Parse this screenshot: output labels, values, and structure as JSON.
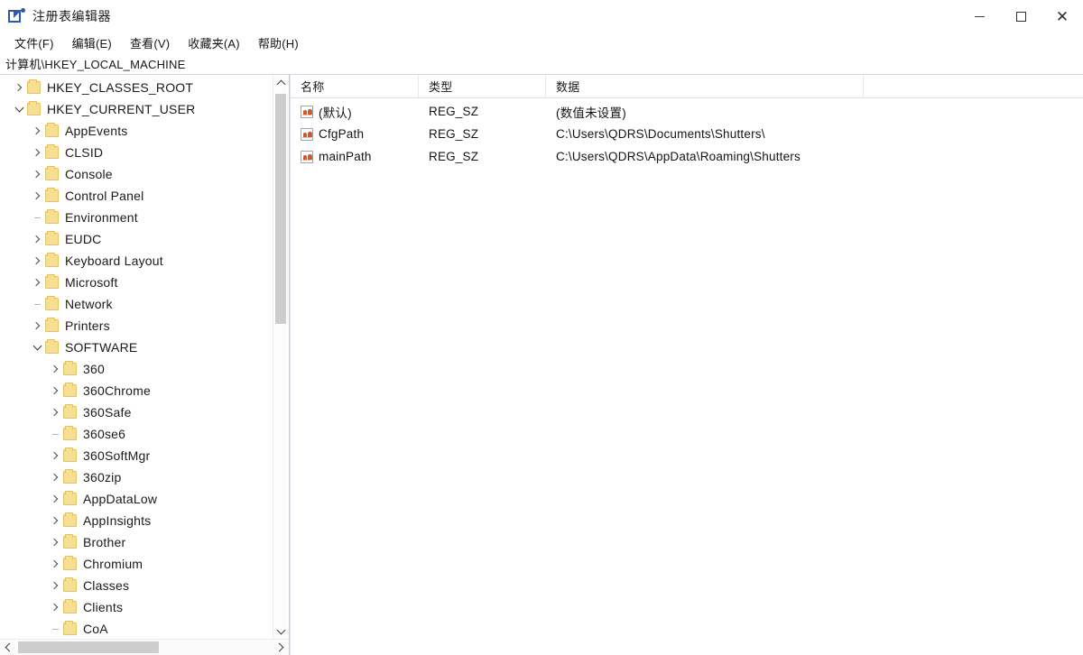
{
  "window": {
    "title": "注册表编辑器",
    "icon": "registry-editor-icon",
    "minimize_label": "最小化",
    "maximize_label": "最大化",
    "close_label": "关闭"
  },
  "menubar": {
    "items": [
      {
        "label": "文件(F)",
        "name": "menu-file"
      },
      {
        "label": "编辑(E)",
        "name": "menu-edit"
      },
      {
        "label": "查看(V)",
        "name": "menu-view"
      },
      {
        "label": "收藏夹(A)",
        "name": "menu-favorites"
      },
      {
        "label": "帮助(H)",
        "name": "menu-help"
      }
    ]
  },
  "address": {
    "path": "计算机\\HKEY_LOCAL_MACHINE"
  },
  "tree": {
    "items": [
      {
        "label": "HKEY_CLASSES_ROOT",
        "level": 0,
        "state": "collapsed"
      },
      {
        "label": "HKEY_CURRENT_USER",
        "level": 0,
        "state": "expanded"
      },
      {
        "label": "AppEvents",
        "level": 1,
        "state": "collapsed"
      },
      {
        "label": "CLSID",
        "level": 1,
        "state": "collapsed"
      },
      {
        "label": "Console",
        "level": 1,
        "state": "collapsed"
      },
      {
        "label": "Control Panel",
        "level": 1,
        "state": "collapsed"
      },
      {
        "label": "Environment",
        "level": 1,
        "state": "leaf"
      },
      {
        "label": "EUDC",
        "level": 1,
        "state": "collapsed"
      },
      {
        "label": "Keyboard Layout",
        "level": 1,
        "state": "collapsed"
      },
      {
        "label": "Microsoft",
        "level": 1,
        "state": "collapsed"
      },
      {
        "label": "Network",
        "level": 1,
        "state": "leaf"
      },
      {
        "label": "Printers",
        "level": 1,
        "state": "collapsed"
      },
      {
        "label": "SOFTWARE",
        "level": 1,
        "state": "expanded"
      },
      {
        "label": "360",
        "level": 2,
        "state": "collapsed"
      },
      {
        "label": "360Chrome",
        "level": 2,
        "state": "collapsed"
      },
      {
        "label": "360Safe",
        "level": 2,
        "state": "collapsed"
      },
      {
        "label": "360se6",
        "level": 2,
        "state": "leaf"
      },
      {
        "label": "360SoftMgr",
        "level": 2,
        "state": "collapsed"
      },
      {
        "label": "360zip",
        "level": 2,
        "state": "collapsed"
      },
      {
        "label": "AppDataLow",
        "level": 2,
        "state": "collapsed"
      },
      {
        "label": "AppInsights",
        "level": 2,
        "state": "collapsed"
      },
      {
        "label": "Brother",
        "level": 2,
        "state": "collapsed"
      },
      {
        "label": "Chromium",
        "level": 2,
        "state": "collapsed"
      },
      {
        "label": "Classes",
        "level": 2,
        "state": "collapsed"
      },
      {
        "label": "Clients",
        "level": 2,
        "state": "collapsed"
      },
      {
        "label": "CoA",
        "level": 2,
        "state": "leaf"
      }
    ],
    "vscrollbar": {
      "up_label": "向上滚动",
      "down_label": "向下滚动"
    },
    "hscrollbar": {
      "left_label": "向左滚动",
      "right_label": "向右滚动"
    }
  },
  "valuelist": {
    "columns": [
      {
        "label": "名称",
        "name": "column-name"
      },
      {
        "label": "类型",
        "name": "column-type"
      },
      {
        "label": "数据",
        "name": "column-data"
      }
    ],
    "rows": [
      {
        "name": "(默认)",
        "type": "REG_SZ",
        "data": "(数值未设置)",
        "icon": "string-value-icon"
      },
      {
        "name": "CfgPath",
        "type": "REG_SZ",
        "data": "C:\\Users\\QDRS\\Documents\\Shutters\\",
        "icon": "string-value-icon"
      },
      {
        "name": "mainPath",
        "type": "REG_SZ",
        "data": "C:\\Users\\QDRS\\AppData\\Roaming\\Shutters",
        "icon": "string-value-icon"
      }
    ]
  },
  "colors": {
    "folder": "#f6df92",
    "folder_border": "#e3c361",
    "accent": "#2a59b8",
    "scrollbar_thumb": "#cdcdcd",
    "text": "#1a1a1a"
  }
}
